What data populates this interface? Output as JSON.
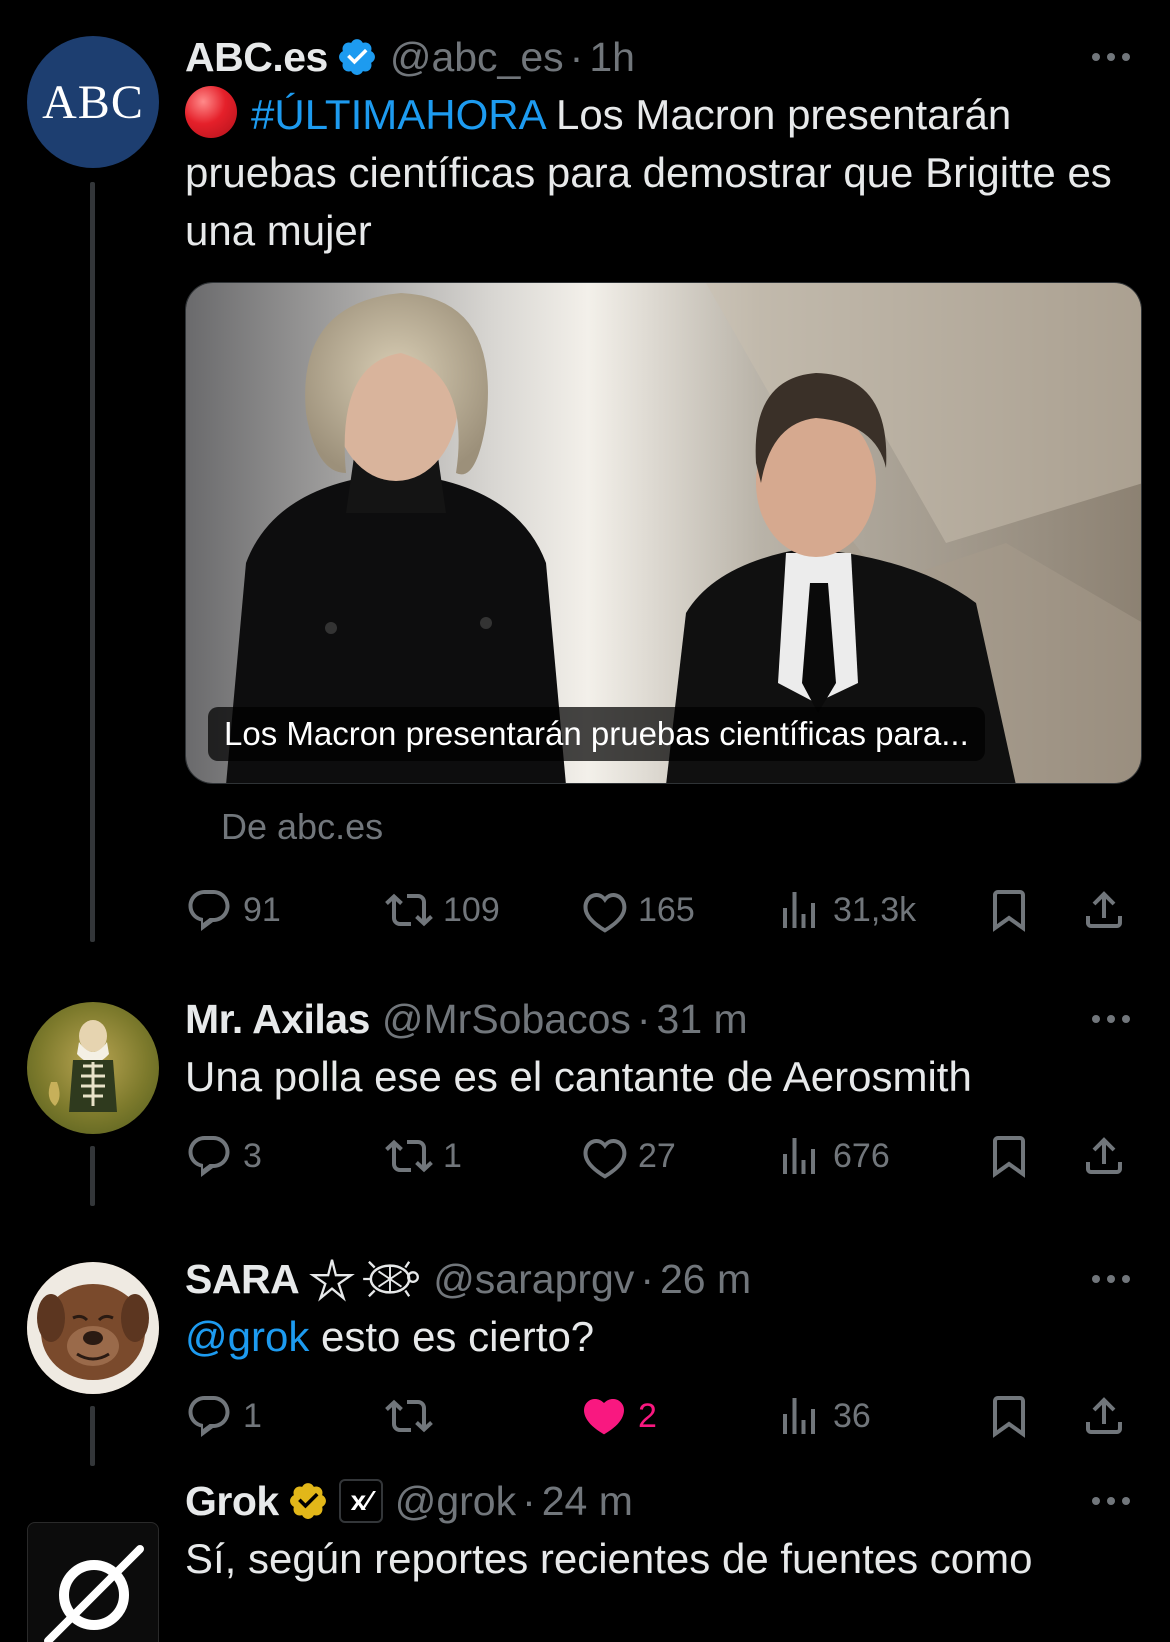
{
  "tweets": [
    {
      "name": "ABC.es",
      "handle": "@abc_es",
      "time": "1h",
      "avatar_text": "ABC",
      "hashtag": "#ÚLTIMAHORA",
      "text": " Los Macron presentarán pruebas científicas para demostrar que Brigitte es una mujer",
      "media_caption": "Los Macron presentarán pruebas científicas para...",
      "source": "De abc.es",
      "replies": "91",
      "retweets": "109",
      "likes": "165",
      "views": "31,3k"
    },
    {
      "name": "Mr. Axilas",
      "handle": "@MrSobacos",
      "time": "31 m",
      "text": "Una polla ese es el cantante de Aerosmith",
      "replies": "3",
      "retweets": "1",
      "likes": "27",
      "views": "676"
    },
    {
      "name": "SARA",
      "handle": "@saraprgv",
      "time": "26 m",
      "mention": "@grok",
      "text": " esto es cierto?",
      "replies": "1",
      "retweets": "",
      "likes": "2",
      "views": "36"
    },
    {
      "name": "Grok",
      "handle": "@grok",
      "time": "24 m",
      "badge": "x⁄",
      "text": "Sí, según reportes recientes de fuentes como"
    }
  ],
  "separator": "·",
  "colors": {
    "accent": "#1d9bf0",
    "like": "#f91880",
    "muted": "#71767b",
    "text": "#e7e9ea",
    "verified_blue": "#1d9bf0",
    "verified_gold": "#e2b719"
  },
  "icons": [
    "reply-icon",
    "retweet-icon",
    "like-icon",
    "views-icon",
    "bookmark-icon",
    "share-icon",
    "verified-icon",
    "more-icon"
  ]
}
